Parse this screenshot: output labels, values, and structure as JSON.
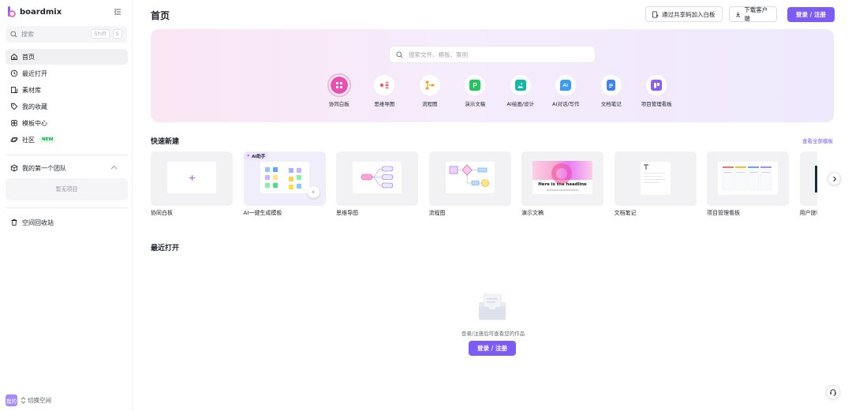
{
  "brand": {
    "name": "boardmix",
    "accent": "#7c5cf5"
  },
  "sidebar": {
    "search_placeholder": "搜索",
    "shortcut_key1": "Shift",
    "shortcut_key2": "S",
    "items": [
      {
        "label": "首页",
        "icon": "home-icon",
        "active": true
      },
      {
        "label": "最近打开",
        "icon": "clock-icon"
      },
      {
        "label": "素材库",
        "icon": "library-icon"
      },
      {
        "label": "我的收藏",
        "icon": "tag-icon"
      },
      {
        "label": "模板中心",
        "icon": "template-icon"
      },
      {
        "label": "社区",
        "icon": "planet-icon",
        "badge": "NEW"
      }
    ],
    "team": {
      "label": "我的第一个团队",
      "empty": "暂无项目"
    },
    "trash": "空间回收站",
    "space": {
      "avatar": "我的",
      "switch_label": "切换空间"
    }
  },
  "header": {
    "title": "首页",
    "join_button": "通过共享码加入白板",
    "download_button": "下载客户端",
    "login_button": "登录 / 注册"
  },
  "hero": {
    "search_placeholder": "搜索文件、模板、案例",
    "tools": [
      {
        "label": "协同白板",
        "icon": "whiteboard-icon",
        "color": "#ec4fb4",
        "active": true
      },
      {
        "label": "思维导图",
        "icon": "mindmap-icon",
        "color": "#f05a5a"
      },
      {
        "label": "流程图",
        "icon": "flowchart-icon",
        "color": "#f5a524"
      },
      {
        "label": "演示文稿",
        "icon": "presentation-icon",
        "color": "#22c55e"
      },
      {
        "label": "AI绘画/设计",
        "icon": "ai-paint-icon",
        "color": "#14b8a6"
      },
      {
        "label": "AI对话/写作",
        "icon": "ai-chat-icon",
        "color": "#3b9cf5"
      },
      {
        "label": "文档笔记",
        "icon": "doc-icon",
        "color": "#3b82f6"
      },
      {
        "label": "项目管理看板",
        "icon": "kanban-icon",
        "color": "#8b5cf6"
      }
    ]
  },
  "quick_create": {
    "title": "快速新建",
    "view_all": "查看全部模板",
    "cards": [
      {
        "label": "协同白板",
        "kind": "blank"
      },
      {
        "label": "AI一键生成模板",
        "kind": "ai",
        "tag": "AI助手"
      },
      {
        "label": "思维导图",
        "kind": "mindmap"
      },
      {
        "label": "流程图",
        "kind": "flow"
      },
      {
        "label": "演示文稿",
        "kind": "slides",
        "headline": "Here is the headline"
      },
      {
        "label": "文档笔记",
        "kind": "doc"
      },
      {
        "label": "项目管理看板",
        "kind": "kanban"
      },
      {
        "label": "用户旅程图",
        "kind": "journey"
      }
    ]
  },
  "recent": {
    "title": "最近打开",
    "empty_text": "登录/注册后可查看您的作品",
    "login_button": "登录 / 注册"
  }
}
